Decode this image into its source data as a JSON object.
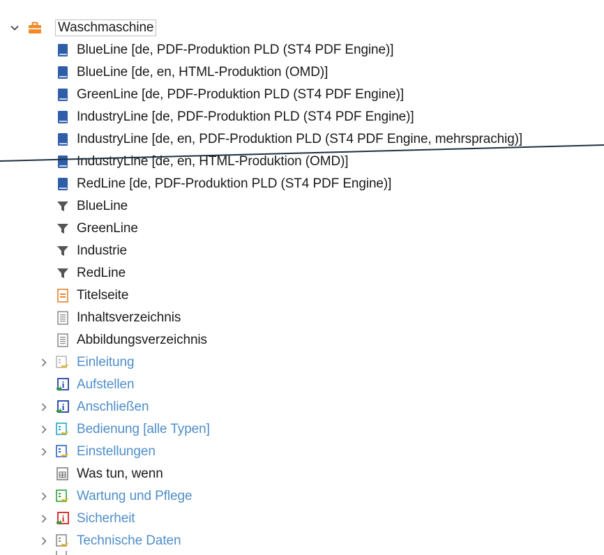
{
  "tree": {
    "root": {
      "label": "Waschmaschine",
      "icon": "briefcase-icon",
      "expanded": true
    },
    "publications": [
      {
        "label": "BlueLine [de, PDF-Produktion PLD (ST4 PDF Engine)]",
        "icon": "book-icon",
        "color": "#2f5ea8"
      },
      {
        "label": "BlueLine [de, en, HTML-Produktion (OMD)]",
        "icon": "book-icon",
        "color": "#2f5ea8"
      },
      {
        "label": "GreenLine [de, PDF-Produktion PLD (ST4 PDF Engine)]",
        "icon": "book-icon",
        "color": "#2f5ea8"
      },
      {
        "label": "IndustryLine [de, PDF-Produktion PLD (ST4 PDF Engine)]",
        "icon": "book-icon",
        "color": "#2f5ea8"
      },
      {
        "label": "IndustryLine [de, en, PDF-Produktion PLD (ST4 PDF Engine, mehrsprachig)]",
        "icon": "book-icon",
        "color": "#2f5ea8"
      },
      {
        "label": "IndustryLine [de, en, HTML-Produktion (OMD)]",
        "icon": "book-icon",
        "color": "#2f5ea8"
      },
      {
        "label": "RedLine [de, PDF-Produktion PLD (ST4 PDF Engine)]",
        "icon": "book-icon",
        "color": "#2f5ea8"
      }
    ],
    "filters": [
      {
        "label": "BlueLine",
        "icon": "filter-icon"
      },
      {
        "label": "GreenLine",
        "icon": "filter-icon"
      },
      {
        "label": "Industrie",
        "icon": "filter-icon"
      },
      {
        "label": "RedLine",
        "icon": "filter-icon"
      }
    ],
    "pages": [
      {
        "label": "Titelseite",
        "icon": "title-page-icon"
      },
      {
        "label": "Inhaltsverzeichnis",
        "icon": "toc-page-icon"
      },
      {
        "label": "Abbildungsverzeichnis",
        "icon": "figure-list-page-icon"
      }
    ],
    "chapters": [
      {
        "label": "Einleitung",
        "icon": "chapter-link-icon",
        "expandable": true,
        "style": "link",
        "color": "#b9b9b9"
      },
      {
        "label": "Aufstellen",
        "icon": "info-chapter-icon",
        "expandable": false,
        "style": "link",
        "color": "#1e3fa8"
      },
      {
        "label": "Anschließen",
        "icon": "info-chapter-icon",
        "expandable": true,
        "style": "link",
        "color": "#1e3fa8"
      },
      {
        "label": "Bedienung [alle Typen]",
        "icon": "chapter-link-icon",
        "expandable": true,
        "style": "link",
        "color": "#1ea6c8"
      },
      {
        "label": "Einstellungen",
        "icon": "chapter-link-icon",
        "expandable": true,
        "style": "link",
        "color": "#2c63c9"
      },
      {
        "label": "Was tun, wenn",
        "icon": "table-page-icon",
        "expandable": false,
        "style": "dark",
        "color": "#6b6b6b"
      },
      {
        "label": "Wartung und Pflege",
        "icon": "chapter-link-icon",
        "expandable": true,
        "style": "link",
        "color": "#2f9e3a"
      },
      {
        "label": "Sicherheit",
        "icon": "info-chapter-icon",
        "expandable": true,
        "style": "link",
        "color": "#d42020"
      },
      {
        "label": "Technische Daten",
        "icon": "chapter-link-icon",
        "expandable": true,
        "style": "link",
        "color": "#8a8a8a"
      }
    ]
  }
}
